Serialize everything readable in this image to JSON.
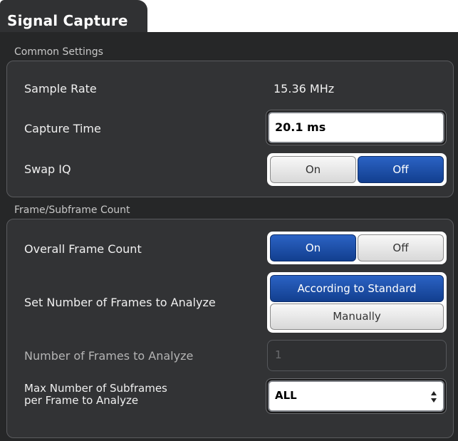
{
  "tab": {
    "title": "Signal Capture"
  },
  "common": {
    "title": "Common Settings",
    "sample_rate": {
      "label": "Sample Rate",
      "value": "15.36 MHz"
    },
    "capture_time": {
      "label": "Capture Time",
      "value": "20.1 ms"
    },
    "swap_iq": {
      "label": "Swap IQ",
      "on": "On",
      "off": "Off",
      "selected": "Off"
    }
  },
  "frame": {
    "title": "Frame/Subframe Count",
    "overall": {
      "label": "Overall Frame Count",
      "on": "On",
      "off": "Off",
      "selected": "On"
    },
    "set_number": {
      "label": "Set Number of Frames to Analyze",
      "option1": "According to Standard",
      "option2": "Manually",
      "selected": "According to Standard"
    },
    "number": {
      "label": "Number of Frames to Analyze",
      "value": "1"
    },
    "max_subframes": {
      "label_line1": "Max Number of Subframes",
      "label_line2": "per Frame to Analyze",
      "value": "ALL"
    }
  },
  "colors": {
    "active": "#1f4fa8",
    "panel": "#262728",
    "group": "#323335"
  }
}
